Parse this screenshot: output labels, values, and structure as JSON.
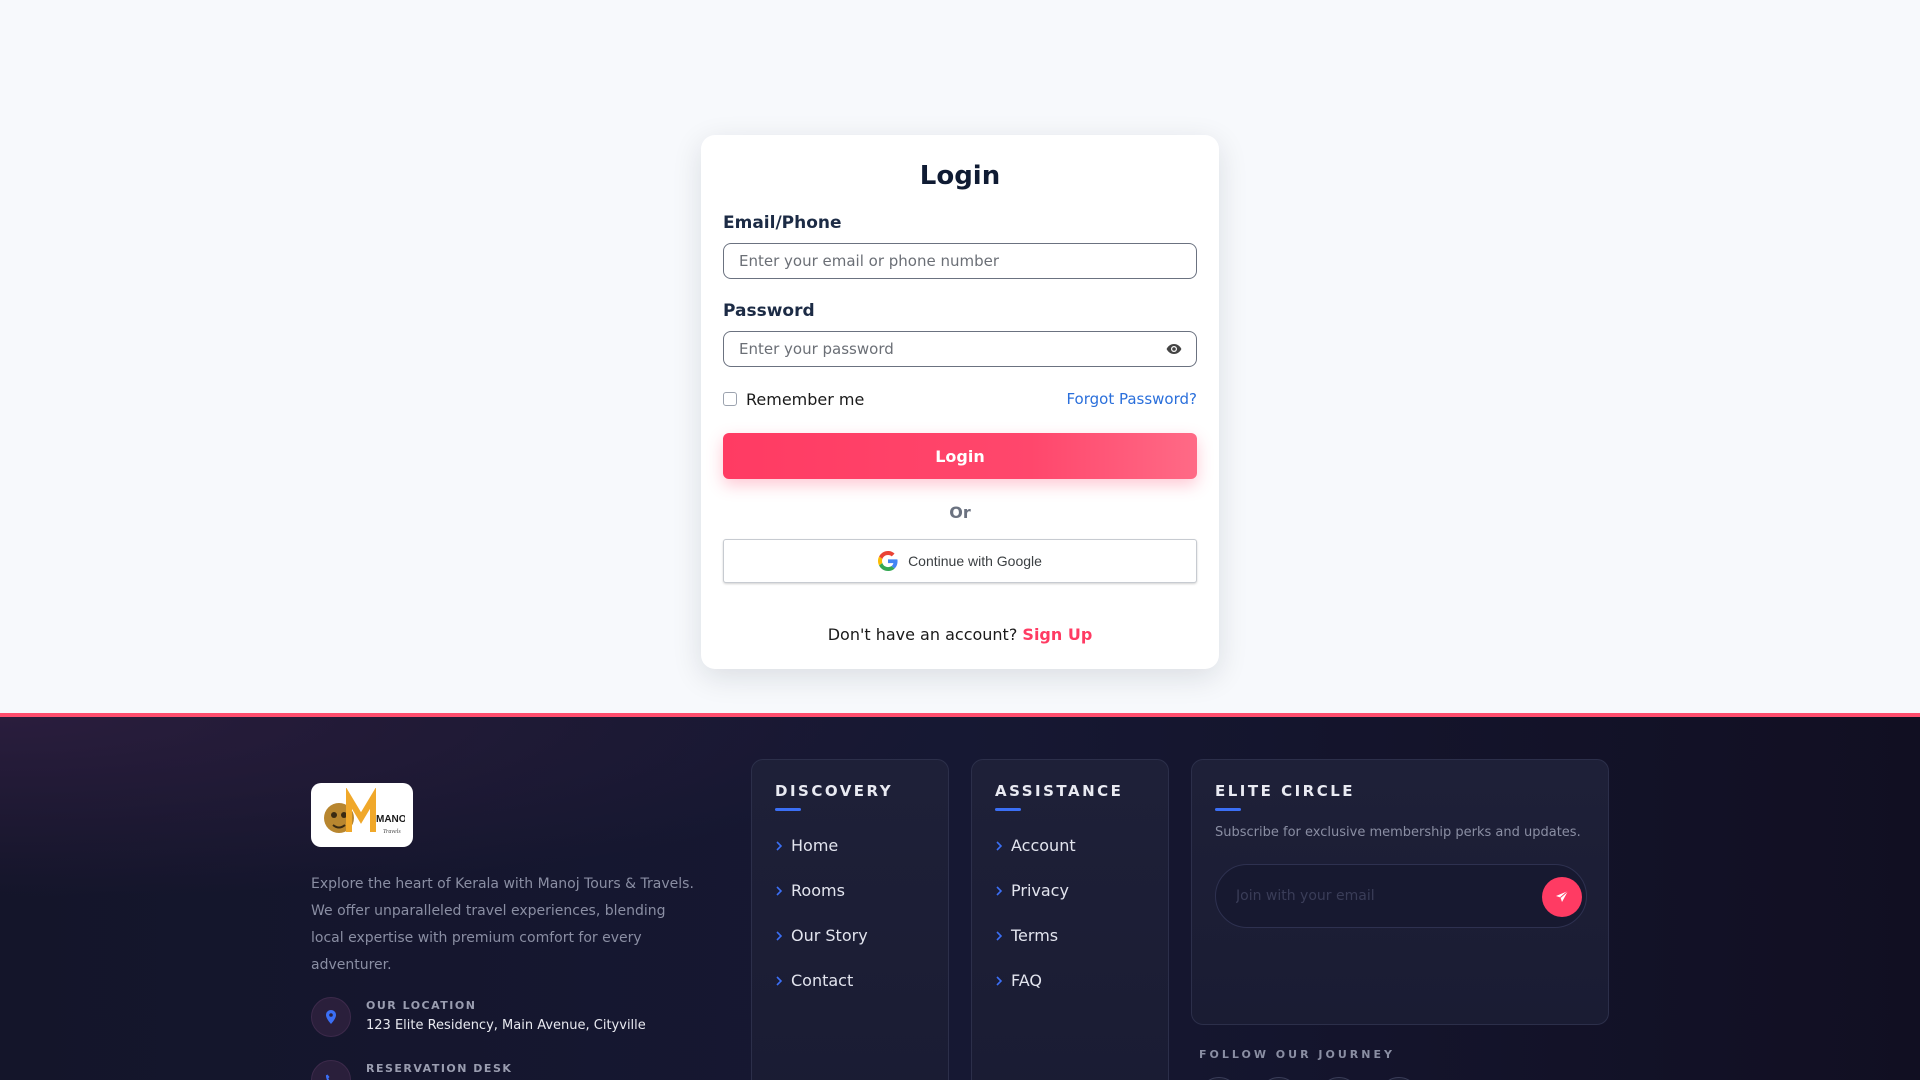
{
  "login": {
    "title": "Login",
    "email_label": "Email/Phone",
    "email_placeholder": "Enter your email or phone number",
    "password_label": "Password",
    "password_placeholder": "Enter your password",
    "remember_label": "Remember me",
    "forgot_label": "Forgot Password?",
    "login_button": "Login",
    "or_text": "Or",
    "google_button": "Continue with Google",
    "signup_prompt": "Don't have an account?",
    "signup_link": "Sign Up"
  },
  "footer": {
    "about": "Explore the heart of Kerala with Manoj Tours & Travels. We offer unparalleled travel experiences, blending local expertise with premium comfort for every adventurer.",
    "logo_text": "MANOJ",
    "logo_subtext": "Travels",
    "contacts": [
      {
        "label": "OUR LOCATION",
        "value": "123 Elite Residency, Main Avenue, Cityville",
        "icon": "map-pin-icon"
      },
      {
        "label": "RESERVATION DESK",
        "value": "",
        "icon": "phone-icon"
      }
    ],
    "discovery": {
      "heading": "DISCOVERY",
      "links": [
        "Home",
        "Rooms",
        "Our Story",
        "Contact"
      ]
    },
    "assistance": {
      "heading": "ASSISTANCE",
      "links": [
        "Account",
        "Privacy",
        "Terms",
        "FAQ"
      ]
    },
    "elite": {
      "heading": "ELITE CIRCLE",
      "subtitle": "Subscribe for exclusive membership perks and updates.",
      "email_placeholder": "Join with your email"
    },
    "follow_label": "FOLLOW OUR JOURNEY"
  },
  "colors": {
    "accent": "#ff3b63",
    "link_blue": "#2a6fdb",
    "footer_bg": "#14152a",
    "heading_bar": "#3b6ff5"
  }
}
